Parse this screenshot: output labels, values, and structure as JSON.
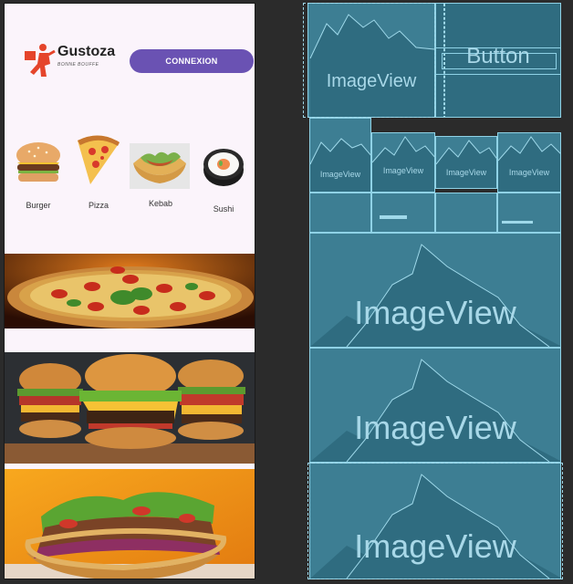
{
  "header": {
    "brand_name": "Gustoza",
    "brand_tagline": "BONNE BOUFFE",
    "connexion_label": "CONNEXION"
  },
  "categories": [
    {
      "label": "Burger",
      "icon": "burger-icon"
    },
    {
      "label": "Pizza",
      "icon": "pizza-icon"
    },
    {
      "label": "Kebab",
      "icon": "kebab-icon"
    },
    {
      "label": "Sushi",
      "icon": "sushi-icon"
    }
  ],
  "banners": [
    {
      "name": "pizza-banner"
    },
    {
      "name": "burger-banner"
    },
    {
      "name": "kebab-banner"
    }
  ],
  "blueprint": {
    "imageview_label": "ImageView",
    "button_label": "Button"
  },
  "colors": {
    "accent": "#6a52b3",
    "screen_bg": "#fbf4fb",
    "blueprint_fill": "#3d7e93",
    "blueprint_line": "#8fd2e6"
  }
}
